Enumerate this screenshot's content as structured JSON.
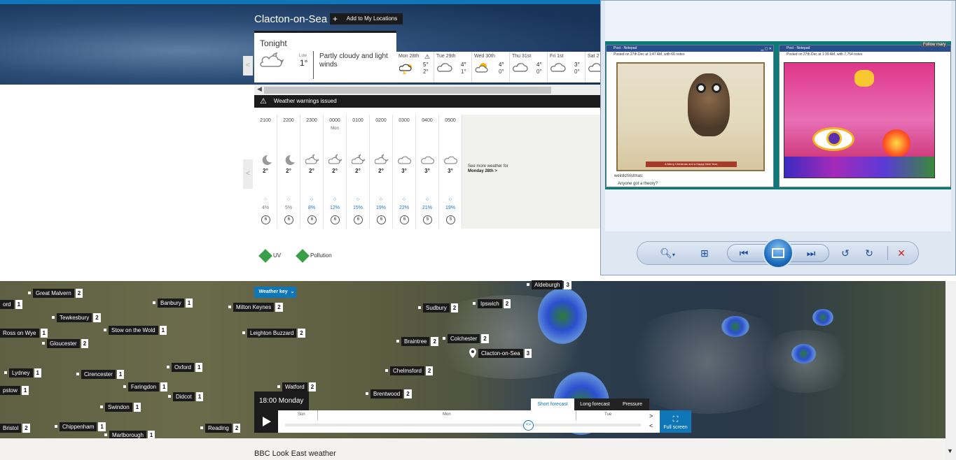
{
  "header": {
    "location": "Clacton-on-Sea",
    "add_location": "Add to My Locations"
  },
  "tonight": {
    "label": "Tonight",
    "low_label": "Low",
    "low_temp": "1°",
    "description": "Partly cloudy and light winds"
  },
  "days": [
    {
      "label": "Mon 28th",
      "hi": "5°",
      "lo": "2°",
      "icon": "thundery-shower-icon",
      "warning": true
    },
    {
      "label": "Tue 29th",
      "hi": "4°",
      "lo": "1°",
      "icon": "cloud-icon",
      "warning": false
    },
    {
      "label": "Wed 30th",
      "hi": "4°",
      "lo": "0°",
      "icon": "sun-cloud-icon",
      "warning": false
    },
    {
      "label": "Thu 31st",
      "hi": "4°",
      "lo": "0°",
      "icon": "cloud-icon",
      "warning": false
    },
    {
      "label": "Fri 1st",
      "hi": "3°",
      "lo": "0°",
      "icon": "cloud-icon",
      "warning": false
    },
    {
      "label": "Sat 2",
      "hi": "",
      "lo": "",
      "icon": "cloud-icon",
      "warning": false
    }
  ],
  "warning_bar": "Weather warnings issued",
  "hourly": [
    {
      "time": "2100",
      "day": "",
      "icon": "moon-icon",
      "temp": "2°",
      "rain": "4%",
      "wind": "6",
      "wet": false
    },
    {
      "time": "2200",
      "day": "",
      "icon": "moon-icon",
      "temp": "2°",
      "rain": "5%",
      "wind": "6",
      "wet": false
    },
    {
      "time": "2300",
      "day": "",
      "icon": "moon-cloud-icon",
      "temp": "2°",
      "rain": "8%",
      "wind": "6",
      "wet": true
    },
    {
      "time": "0000",
      "day": "Mon",
      "icon": "moon-cloud-icon",
      "temp": "2°",
      "rain": "12%",
      "wind": "6",
      "wet": true
    },
    {
      "time": "0100",
      "day": "",
      "icon": "moon-cloud-icon",
      "temp": "2°",
      "rain": "15%",
      "wind": "6",
      "wet": true
    },
    {
      "time": "0200",
      "day": "",
      "icon": "moon-cloud-icon",
      "temp": "2°",
      "rain": "19%",
      "wind": "6",
      "wet": true
    },
    {
      "time": "0300",
      "day": "",
      "icon": "cloud-icon",
      "temp": "3°",
      "rain": "22%",
      "wind": "6",
      "wet": true
    },
    {
      "time": "0400",
      "day": "",
      "icon": "cloud-icon",
      "temp": "3°",
      "rain": "21%",
      "wind": "5",
      "wet": true
    },
    {
      "time": "0500",
      "day": "",
      "icon": "cloud-icon",
      "temp": "3°",
      "rain": "19%",
      "wind": "5",
      "wet": true
    }
  ],
  "more_weather": {
    "text": "See more weather for",
    "link": "Monday 28th >"
  },
  "badges": {
    "uv": "UV",
    "pollution": "Pollution",
    "badge_letter": "L"
  },
  "map": {
    "weather_key": "Weather key",
    "towns": [
      {
        "name": "Great Malvern",
        "num": "2"
      },
      {
        "name": "Banbury",
        "num": "1"
      },
      {
        "name": "Milton Keynes",
        "num": "2"
      },
      {
        "name": "Sudbury",
        "num": "2"
      },
      {
        "name": "Ipswich",
        "num": "2"
      },
      {
        "name": "Aldeburgh",
        "num": "3"
      },
      {
        "name": "Tewkesbury",
        "num": "2"
      },
      {
        "name": "Stow on the Wold",
        "num": "1"
      },
      {
        "name": "Leighton Buzzard",
        "num": "2"
      },
      {
        "name": "Ross on Wye",
        "num": "1"
      },
      {
        "name": "Gloucester",
        "num": "2"
      },
      {
        "name": "Braintree",
        "num": "2"
      },
      {
        "name": "Colchester",
        "num": "2"
      },
      {
        "name": "Clacton-on-Sea",
        "num": "3"
      },
      {
        "name": "Lydney",
        "num": "1"
      },
      {
        "name": "Cirencester",
        "num": "1"
      },
      {
        "name": "Oxford",
        "num": "1"
      },
      {
        "name": "Chelmsford",
        "num": "2"
      },
      {
        "name": "Faringdon",
        "num": "1"
      },
      {
        "name": "Didcot",
        "num": "1"
      },
      {
        "name": "Watford",
        "num": "2"
      },
      {
        "name": "Brentwood",
        "num": "2"
      },
      {
        "name": "pstow",
        "num": "1"
      },
      {
        "name": "Swindon",
        "num": "1"
      },
      {
        "name": "Bristol",
        "num": "2"
      },
      {
        "name": "Chippenham",
        "num": "1"
      },
      {
        "name": "Reading",
        "num": "2"
      },
      {
        "name": "Marlborough",
        "num": "1"
      },
      {
        "name": "ord",
        "num": "1"
      }
    ],
    "time_label": "18:00 Monday",
    "timeline_days": [
      "Sun",
      "Mon",
      "Tue"
    ],
    "tabs": {
      "short": "Short forecast",
      "long": "Long forecast",
      "pressure": "Pressure"
    },
    "fullscreen": "Full screen",
    "handle": "<>"
  },
  "footer": {
    "title": "BBC Look East weather"
  },
  "viewer": {
    "np1": {
      "title": "Post - Notepad",
      "sub": "Posted on 27th Dec at 1:47 AM, with 66 notes",
      "caption": "A Merry Christmas and a Happy New Year.",
      "foot1": "weirdchristmas:",
      "foot2": "Anyone got a theory?"
    },
    "np2": {
      "title": "Post - Notepad",
      "sub": "Posted on 27th Dec at 1:39 AM, with 7,754 notes"
    },
    "follow": "Follow mary"
  }
}
